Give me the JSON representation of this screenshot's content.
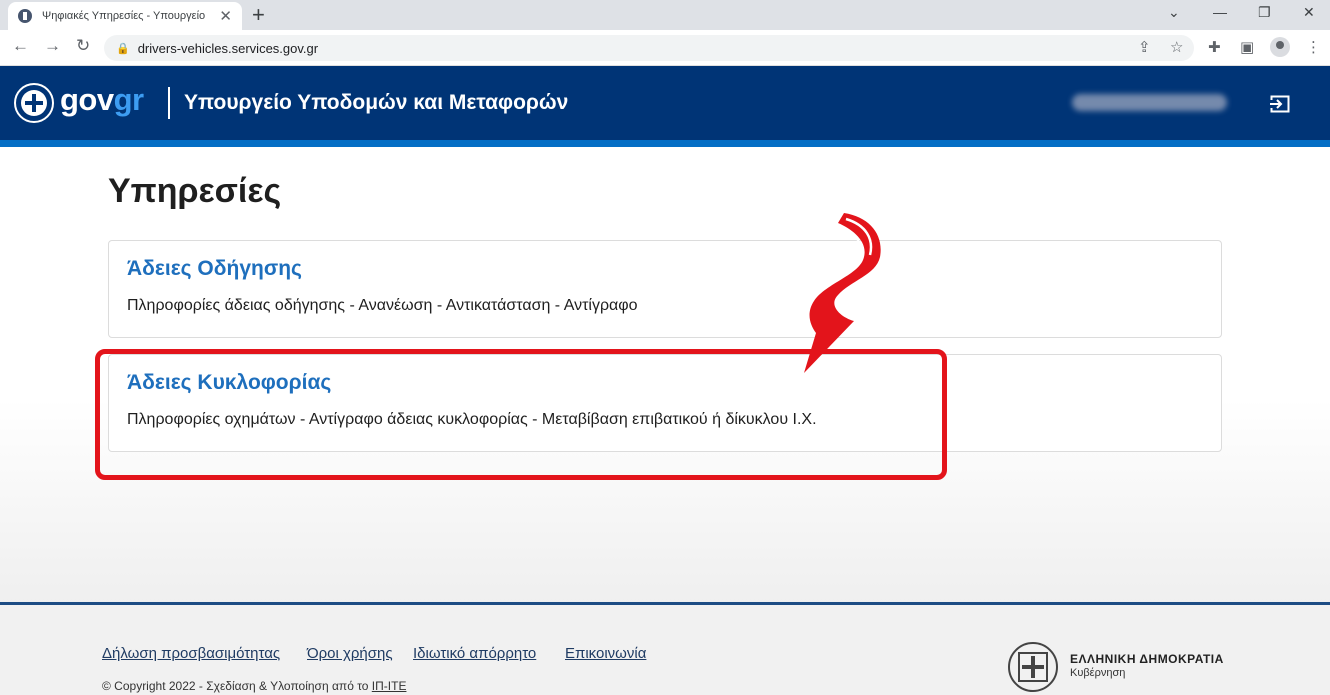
{
  "browser": {
    "tab_title": "Ψηφιακές Υπηρεσίες - Υπουργείο",
    "tab_close": "✕",
    "new_tab": "+",
    "url": "drivers-vehicles.services.gov.gr",
    "back": "←",
    "forward": "→",
    "reload": "↻",
    "lock": "🔒",
    "share": "⇪",
    "star": "☆",
    "extensions": "✚",
    "sidepanel": "▣",
    "menu": "⋮",
    "minimize": "—",
    "restore": "❐",
    "close": "✕",
    "tabsearch": "⌄"
  },
  "header": {
    "logo_gov": "gov",
    "logo_gr": "gr",
    "ministry": "Υπουργείο Υποδομών και Μεταφορών"
  },
  "page": {
    "title": "Υπηρεσίες",
    "cards": [
      {
        "title": "Άδειες Οδήγησης",
        "description": "Πληροφορίες άδειας οδήγησης - Ανανέωση - Αντικατάσταση - Αντίγραφο"
      },
      {
        "title": "Άδειες Κυκλοφορίας",
        "description": "Πληροφορίες οχημάτων - Αντίγραφο άδειας κυκλοφορίας - Μεταβίβαση επιβατικού ή δίκυκλου Ι.Χ."
      }
    ]
  },
  "footer": {
    "links": [
      "Δήλωση προσβασιμότητας",
      "Όροι χρήσης",
      "Ιδιωτικό απόρρητο",
      "Επικοινωνία"
    ],
    "copyright_prefix": "© Copyright 2022 - Σχεδίαση & Υλοποίηση από το ",
    "copyright_org": "ΙΠ-ΙΤΕ",
    "gov_name": "ΕΛΛΗΝΙΚΗ ΔΗΜΟΚΡΑΤΙΑ",
    "gov_sub": "Κυβέρνηση"
  },
  "colors": {
    "header_bg": "#003476",
    "header_stripe": "#046ec5",
    "card_title": "#1e6fbd",
    "highlight": "#e3141b"
  },
  "icons": {
    "logout": "logout-icon",
    "emblem": "greek-emblem-icon"
  }
}
